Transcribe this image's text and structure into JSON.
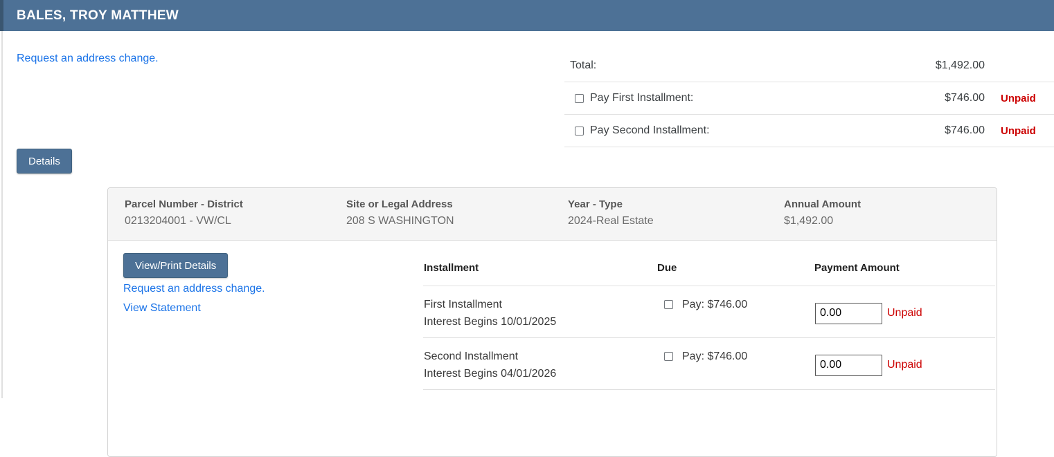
{
  "header": {
    "title": "BALES, TROY MATTHEW"
  },
  "links": {
    "address_change_top": "Request an address change.",
    "address_change_card": "Request an address change.",
    "view_statement": "View Statement"
  },
  "summary": {
    "total_label": "Total:",
    "total_amount": "$1,492.00",
    "rows": [
      {
        "label": "Pay First Installment:",
        "amount": "$746.00",
        "status": "Unpaid"
      },
      {
        "label": "Pay Second Installment:",
        "amount": "$746.00",
        "status": "Unpaid"
      }
    ]
  },
  "details_button": "Details",
  "card": {
    "fields": [
      {
        "label": "Parcel Number - District",
        "value": "0213204001 - VW/CL"
      },
      {
        "label": "Site or Legal Address",
        "value": "208 S WASHINGTON"
      },
      {
        "label": "Year - Type",
        "value": "2024-Real Estate"
      },
      {
        "label": "Annual Amount",
        "value": "$1,492.00"
      }
    ],
    "view_print_button": "View/Print Details",
    "table": {
      "headers": [
        "Installment",
        "Due",
        "Payment Amount"
      ],
      "rows": [
        {
          "name": "First Installment",
          "interest": "Interest Begins 10/01/2025",
          "due": "Pay: $746.00",
          "payment_value": "0.00",
          "status": "Unpaid"
        },
        {
          "name": "Second Installment",
          "interest": "Interest Begins 04/01/2026",
          "due": "Pay: $746.00",
          "payment_value": "0.00",
          "status": "Unpaid"
        }
      ]
    }
  },
  "colors": {
    "header_bg": "#4d7196",
    "link_blue": "#1a73e8",
    "unpaid_red": "#cc0000"
  }
}
